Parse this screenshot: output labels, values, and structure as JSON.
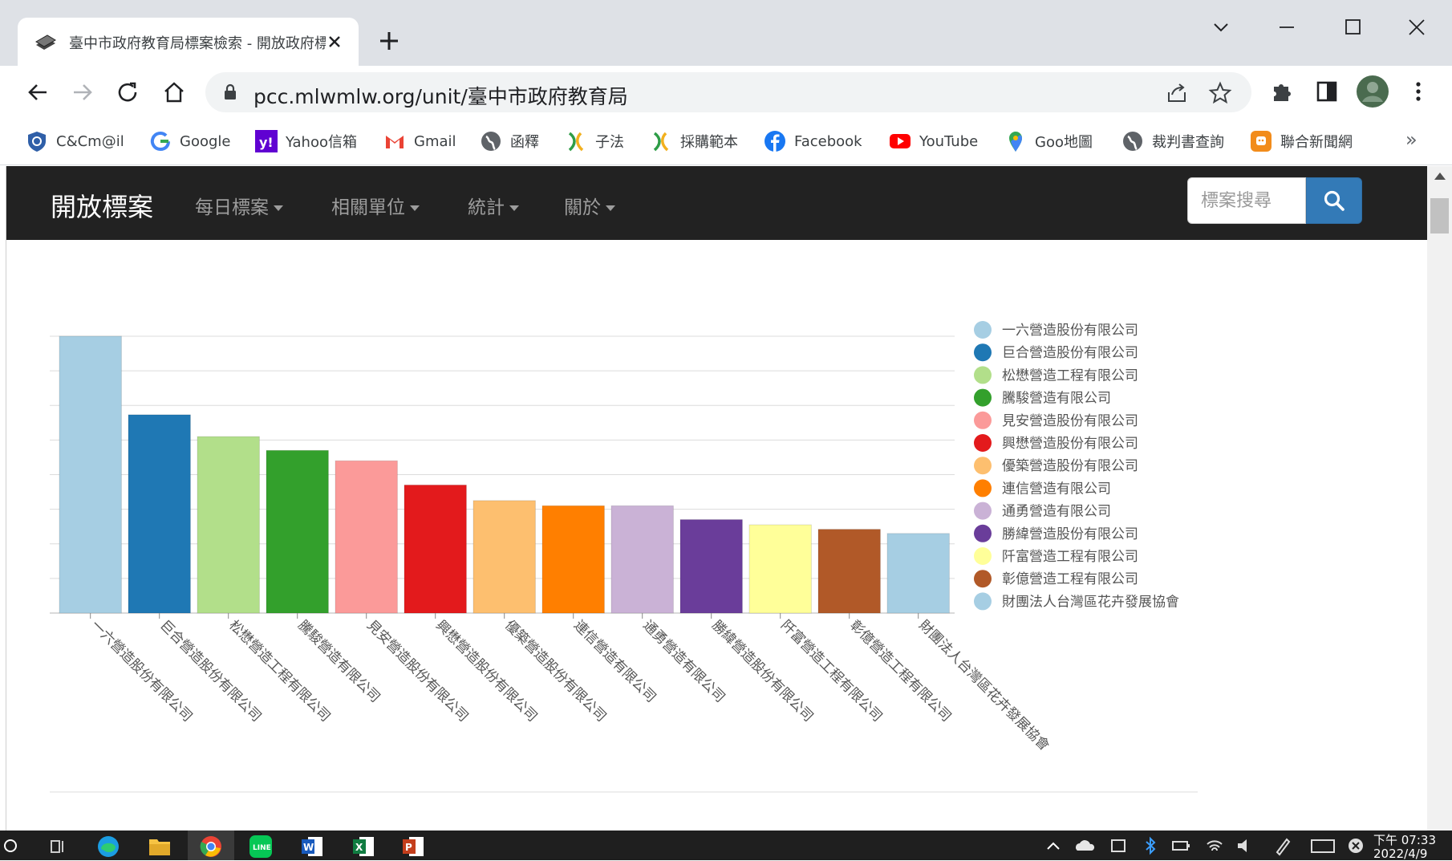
{
  "browser": {
    "tab_title": "臺中市政府教育局標案檢索 - 開放政府標",
    "url": "pcc.mlwmlw.org/unit/臺中市政府教育局",
    "bookmarks": [
      {
        "label": "C&Cm@il",
        "icon": "mail-shield-icon"
      },
      {
        "label": "Google",
        "icon": "google-icon"
      },
      {
        "label": "Yahoo信箱",
        "icon": "yahoo-icon"
      },
      {
        "label": "Gmail",
        "icon": "gmail-icon"
      },
      {
        "label": "函釋",
        "icon": "globe-icon"
      },
      {
        "label": "子法",
        "icon": "law-icon"
      },
      {
        "label": "採購範本",
        "icon": "law-icon"
      },
      {
        "label": "Facebook",
        "icon": "facebook-icon"
      },
      {
        "label": "YouTube",
        "icon": "youtube-icon"
      },
      {
        "label": "Goo地圖",
        "icon": "maps-icon"
      },
      {
        "label": "裁判書查詢",
        "icon": "globe-icon"
      },
      {
        "label": "聯合新聞網",
        "icon": "news-icon"
      }
    ],
    "bookmarks_more": "»"
  },
  "site": {
    "brand": "開放標案",
    "menus": [
      "每日標案",
      "相關單位",
      "統計",
      "關於"
    ],
    "search_placeholder": "標案搜尋"
  },
  "chart_data": {
    "type": "bar",
    "categories": [
      "一六營造股份有限公司",
      "巨合營造股份有限公司",
      "松懋營造工程有限公司",
      "騰駿營造有限公司",
      "見安營造股份有限公司",
      "興懋營造股份有限公司",
      "優築營造股份有限公司",
      "連信營造有限公司",
      "通勇營造有限公司",
      "勝緯營造股份有限公司",
      "阡富營造工程有限公司",
      "彰億營造工程有限公司",
      "財團法人台灣區花卉發展協會"
    ],
    "values": [
      8.0,
      5.73,
      5.1,
      4.7,
      4.4,
      3.7,
      3.25,
      3.1,
      3.1,
      2.7,
      2.55,
      2.42,
      2.3
    ],
    "colors": [
      "#a6cee3",
      "#1f78b4",
      "#b2df8a",
      "#33a02c",
      "#fb9a99",
      "#e31a1c",
      "#fdbf6f",
      "#ff7f00",
      "#cab2d6",
      "#6a3d9a",
      "#ffff99",
      "#b15928",
      "#a6cee3"
    ],
    "ylim": [
      0,
      8
    ],
    "grid": true,
    "legend": "right",
    "title": "",
    "xlabel": "",
    "ylabel": ""
  },
  "taskbar": {
    "clock_time": "下午 07:33",
    "clock_date": "2022/4/9"
  }
}
